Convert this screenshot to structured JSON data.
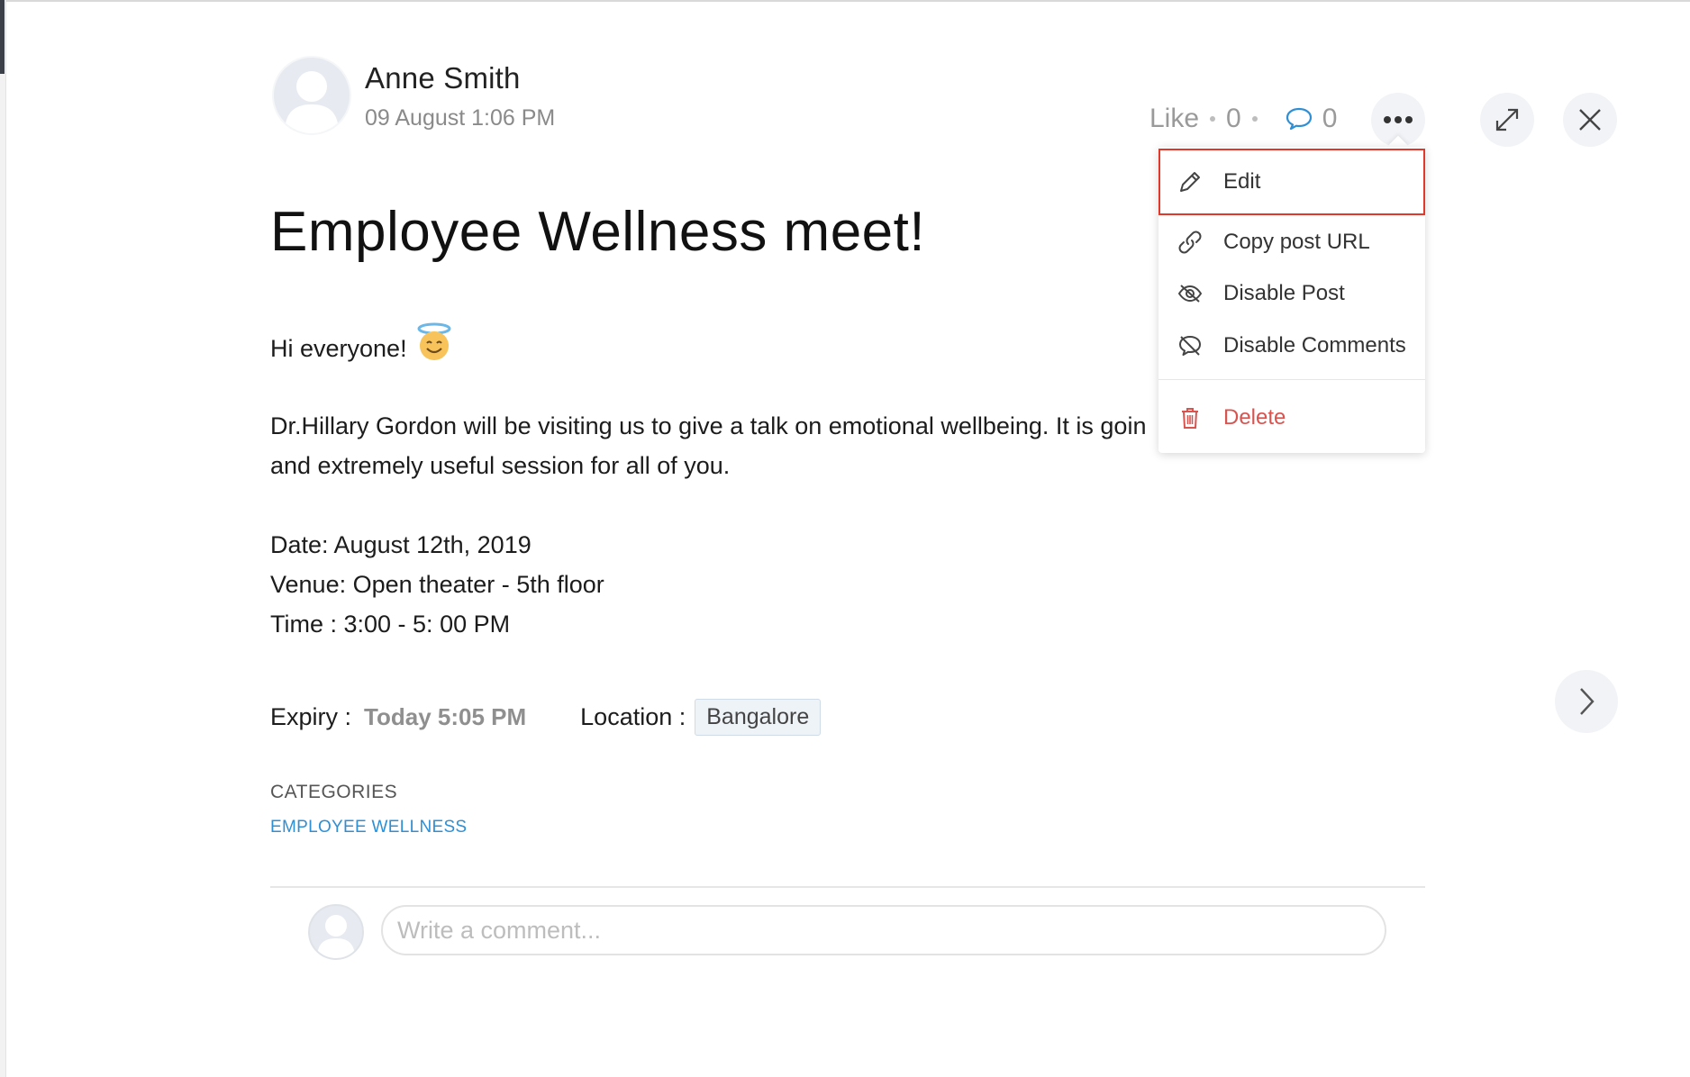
{
  "post": {
    "author": "Anne Smith",
    "timestamp": "09 August 1:06 PM",
    "title": "Employee Wellness meet!",
    "greeting": "Hi everyone!",
    "paragraph_line1": "Dr.Hillary Gordon will be visiting us to give a talk on emotional wellbeing. It is goin",
    "paragraph_line2": "and extremely useful session for all of you.",
    "date": "Date: August 12th, 2019",
    "venue": "Venue: Open theater - 5th floor",
    "time": "Time : 3:00 - 5: 00 PM",
    "expiry_label": "Expiry :",
    "expiry_value": "Today 5:05 PM",
    "location_label": "Location :",
    "location_value": "Bangalore",
    "categories_label": "CATEGORIES",
    "category": "EMPLOYEE WELLNESS"
  },
  "stats": {
    "like_label": "Like",
    "like_count": "0",
    "comment_count": "0"
  },
  "menu": {
    "edit": "Edit",
    "copy_url": "Copy post URL",
    "disable_post": "Disable Post",
    "disable_comments": "Disable Comments",
    "delete": "Delete"
  },
  "comment": {
    "placeholder": "Write a comment..."
  },
  "colors": {
    "accent_blue": "#2f8fd5",
    "delete_red": "#d9534f",
    "highlight_red": "#e0392b"
  },
  "icons": [
    "avatar-icon",
    "comment-bubble-icon",
    "more-options-icon",
    "expand-icon",
    "close-icon",
    "pencil-icon",
    "link-icon",
    "eye-slash-icon",
    "comment-slash-icon",
    "trash-icon",
    "chevron-right-icon",
    "halo-smile-emoji"
  ]
}
